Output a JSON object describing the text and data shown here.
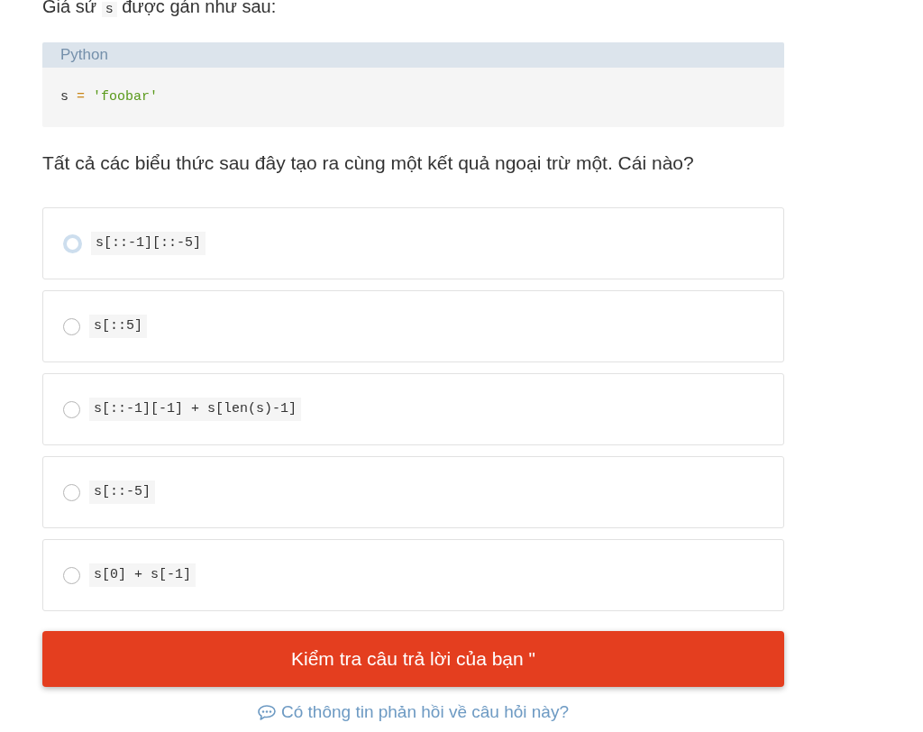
{
  "intro": {
    "parts": [
      {
        "kind": "text",
        "text": "Giá sử "
      },
      {
        "kind": "code",
        "text": "s"
      },
      {
        "kind": "text",
        "text": " được gán như sau:"
      }
    ]
  },
  "code_block": {
    "language": "Python",
    "tokens": [
      {
        "kind": "name",
        "text": "s"
      },
      {
        "kind": "operator",
        "text": "="
      },
      {
        "kind": "string",
        "text": "'foobar'"
      }
    ]
  },
  "question": "Tất cả các biểu thức sau đây tạo ra cùng một kết quả ngoại trừ một. Cái nào?",
  "options": [
    {
      "code": "s[::-1][::-5]",
      "selected": false,
      "focused": true
    },
    {
      "code": "s[::5]",
      "selected": false,
      "focused": false
    },
    {
      "code": "s[::-1][-1] + s[len(s)-1]",
      "selected": false,
      "focused": false
    },
    {
      "code": "s[::-5]",
      "selected": false,
      "focused": false
    },
    {
      "code": "s[0] + s[-1]",
      "selected": false,
      "focused": false
    }
  ],
  "submit_button": "Kiểm tra câu trả lời của bạn \"",
  "feedback_link": "Có thông tin phản hồi về câu hỏi này?"
}
